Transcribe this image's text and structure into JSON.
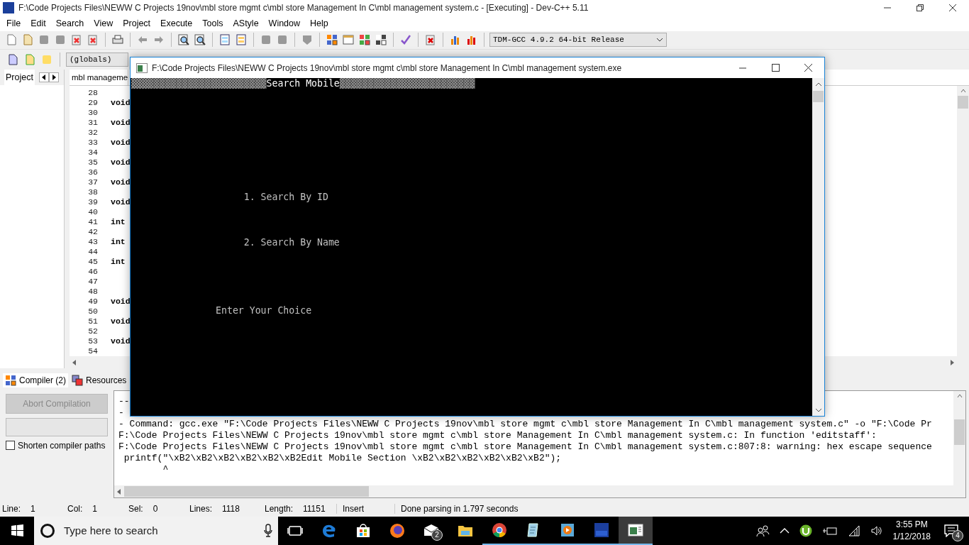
{
  "window": {
    "title": "F:\\Code Projects Files\\NEWW C Projects 19nov\\mbl store mgmt c\\mbl store Management In C\\mbl management system.c - [Executing] - Dev-C++ 5.11"
  },
  "menu": [
    "File",
    "Edit",
    "Search",
    "View",
    "Project",
    "Execute",
    "Tools",
    "AStyle",
    "Window",
    "Help"
  ],
  "compiler_select": {
    "value": "TDM-GCC 4.9.2 64-bit Release"
  },
  "scope_select": {
    "value": "(globals)"
  },
  "project_panel": {
    "tab": "Project"
  },
  "editor": {
    "tab": "mbl manageme",
    "lines": [
      {
        "number": "28"
      },
      {
        "number": "29",
        "code": "void"
      },
      {
        "number": "30"
      },
      {
        "number": "31",
        "code": "void"
      },
      {
        "number": "32"
      },
      {
        "number": "33",
        "code": "void"
      },
      {
        "number": "34"
      },
      {
        "number": "35",
        "code": "void"
      },
      {
        "number": "36"
      },
      {
        "number": "37",
        "code": "void"
      },
      {
        "number": "38"
      },
      {
        "number": "39",
        "code": "void"
      },
      {
        "number": "40"
      },
      {
        "number": "41",
        "code": "int"
      },
      {
        "number": "42"
      },
      {
        "number": "43",
        "code": "int"
      },
      {
        "number": "44"
      },
      {
        "number": "45",
        "code": "int"
      },
      {
        "number": "46"
      },
      {
        "number": "47"
      },
      {
        "number": "48"
      },
      {
        "number": "49",
        "code": "void"
      },
      {
        "number": "50"
      },
      {
        "number": "51",
        "code": "void"
      },
      {
        "number": "52"
      },
      {
        "number": "53",
        "code": "void"
      },
      {
        "number": "54"
      }
    ]
  },
  "bottom_tabs": [
    {
      "label": "Compiler (2)",
      "selected": true
    },
    {
      "label": "Resources",
      "selected": false
    }
  ],
  "compiler_panel": {
    "abort_button": {
      "label": "Abort Compilation",
      "disabled": true
    },
    "shorten_paths": {
      "label": "Shorten compiler paths",
      "checked": false
    },
    "progress": {
      "level": 0
    },
    "log": [
      "--",
      "-",
      "- Command: gcc.exe \"F:\\Code Projects Files\\NEWW C Projects 19nov\\mbl store mgmt c\\mbl store Management In C\\mbl management system.c\" -o \"F:\\Code Pr",
      "F:\\Code Projects Files\\NEWW C Projects 19nov\\mbl store mgmt c\\mbl store Management In C\\mbl management system.c: In function 'editstaff':",
      "F:\\Code Projects Files\\NEWW C Projects 19nov\\mbl store mgmt c\\mbl store Management In C\\mbl management system.c:807:8: warning: hex escape sequence",
      " printf(\"\\xB2\\xB2\\xB2\\xB2\\xB2\\xB2Edit Mobile Section \\xB2\\xB2\\xB2\\xB2\\xB2\\xB2\");",
      "        ^"
    ]
  },
  "status_bar": [
    {
      "label": "Line:",
      "value": "1"
    },
    {
      "label": "Col:",
      "value": "1"
    },
    {
      "label": "Sel:",
      "value": "0"
    },
    {
      "label": "Lines:",
      "value": "1118"
    },
    {
      "label": "Length:",
      "value": "11151"
    },
    {
      "value": "Insert"
    },
    {
      "value": "Done parsing in 1.797 seconds"
    }
  ],
  "console": {
    "title": "F:\\Code Projects Files\\NEWW C Projects 19nov\\mbl store mgmt c\\mbl store Management In C\\mbl management system.exe",
    "header": {
      "bar_left": "▓▓▓▓▓▓▓▓▓▓▓▓▓▓▓▓▓▓▓▓▓▓▓▓",
      "title": "Search Mobile",
      "bar_right": "▓▓▓▓▓▓▓▓▓▓▓▓▓▓▓▓▓▓▓▓▓▓▓▓"
    },
    "output": "\n\n\n\n\n\n\n\n\n                    1. Search By ID\n\n\n\n                    2. Search By Name\n\n\n\n\n\n               Enter Your Choice"
  },
  "taskbar": {
    "search_placeholder": "Type here to search",
    "apps": [
      {
        "kind": "taskview",
        "running": false,
        "selected": false
      },
      {
        "kind": "edge",
        "running": false,
        "selected": false
      },
      {
        "kind": "store",
        "running": false,
        "selected": false
      },
      {
        "kind": "firefox",
        "running": false,
        "selected": false
      },
      {
        "kind": "mail",
        "running": false,
        "selected": false,
        "badge": "2"
      },
      {
        "kind": "explorer",
        "running": false,
        "selected": false
      },
      {
        "kind": "chrome",
        "running": true,
        "selected": false
      },
      {
        "kind": "notepad",
        "running": true,
        "selected": false
      },
      {
        "kind": "media",
        "running": true,
        "selected": false
      },
      {
        "kind": "devcpp",
        "running": true,
        "selected": false
      },
      {
        "kind": "console",
        "running": true,
        "selected": true
      }
    ],
    "time": "3:55 PM",
    "date": "1/12/2018",
    "notifications": "4"
  }
}
